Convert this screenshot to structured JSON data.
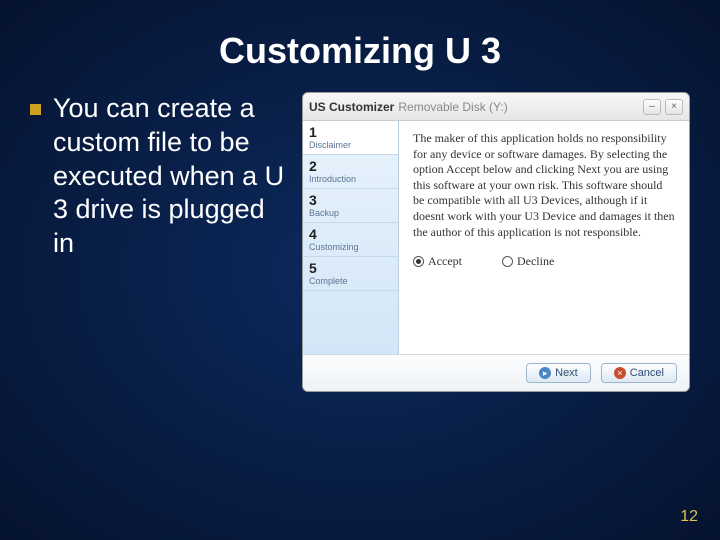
{
  "title": "Customizing U 3",
  "bullet": "You can create a custom file to be executed when a U 3 drive is plugged in",
  "page_number": "12",
  "window": {
    "app_title": "US Customizer",
    "app_subtitle": "Removable Disk (Y:)",
    "steps": [
      {
        "num": "1",
        "label": "Disclaimer"
      },
      {
        "num": "2",
        "label": "Introduction"
      },
      {
        "num": "3",
        "label": "Backup"
      },
      {
        "num": "4",
        "label": "Customizing"
      },
      {
        "num": "5",
        "label": "Complete"
      }
    ],
    "active_step": 0,
    "disclaimer": "The maker of this application holds no responsibility for any device or software damages. By selecting the option Accept below and clicking Next you are using this software at your own risk. This software should be compatible with all U3 Devices, although if it doesnt work with your U3 Device and damages it then the author of this application is not responsible.",
    "accept_label": "Accept",
    "decline_label": "Decline",
    "next_label": "Next",
    "cancel_label": "Cancel"
  }
}
